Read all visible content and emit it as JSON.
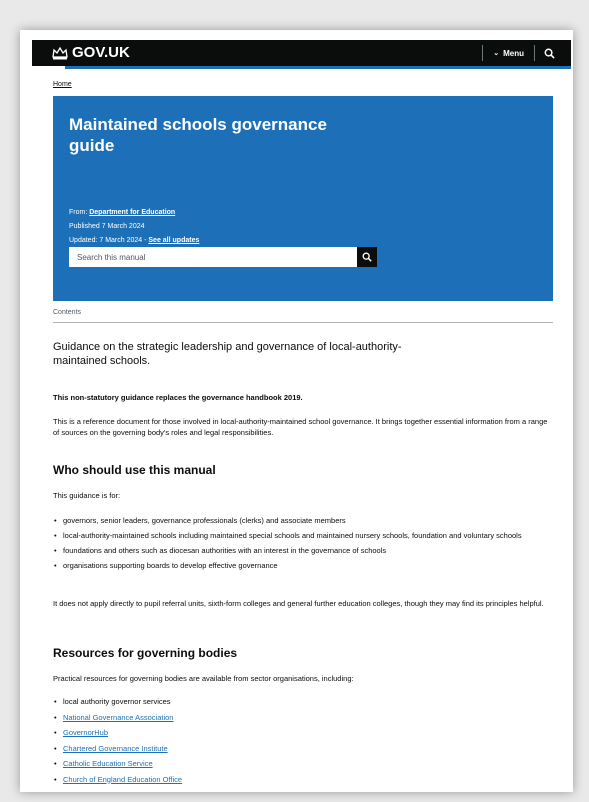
{
  "header": {
    "logo_text": "GOV.UK",
    "menu_label": "Menu"
  },
  "breadcrumb": {
    "home": "Home"
  },
  "hero": {
    "title": "Maintained schools governance guide",
    "from_label": "From:",
    "from_org": "Department for Education",
    "published": "Published 7 March 2024",
    "updated_label": "Updated: 7 March 2024 -",
    "see_all_updates": "See all updates",
    "search_placeholder": "Search this manual"
  },
  "contents_label": "Contents",
  "intro": {
    "lead": "Guidance on the strategic leadership and governance of local-authority-maintained schools.",
    "strong": "This non-statutory guidance replaces the governance handbook 2019.",
    "paragraph": "This is a reference document for those involved in local-authority-maintained school governance. It brings together essential information from a range of sources on the governing body's roles and legal responsibilities."
  },
  "who": {
    "heading": "Who should use this manual",
    "intro": "This guidance is for:",
    "items": [
      "governors, senior leaders, governance professionals (clerks) and associate members",
      "local-authority-maintained schools including maintained special schools and maintained nursery schools, foundation and voluntary schools",
      "foundations and others such as diocesan authorities with an interest in the governance of schools",
      "organisations supporting boards to develop effective governance"
    ],
    "note": "It does not apply directly to pupil referral units, sixth-form colleges and general further education colleges, though they may find its principles helpful."
  },
  "resources": {
    "heading": "Resources for governing bodies",
    "intro": "Practical resources for governing bodies are available from sector organisations, including:",
    "plain_item": "local authority governor services",
    "links": [
      "National Governance Association",
      "GovernorHub",
      "Chartered Governance Institute",
      "Catholic Education Service",
      "Church of England Education Office"
    ]
  },
  "colors": {
    "hero_blue": "#1d70b8",
    "header_black": "#0b0c0c",
    "link_blue": "#1d70b8"
  }
}
